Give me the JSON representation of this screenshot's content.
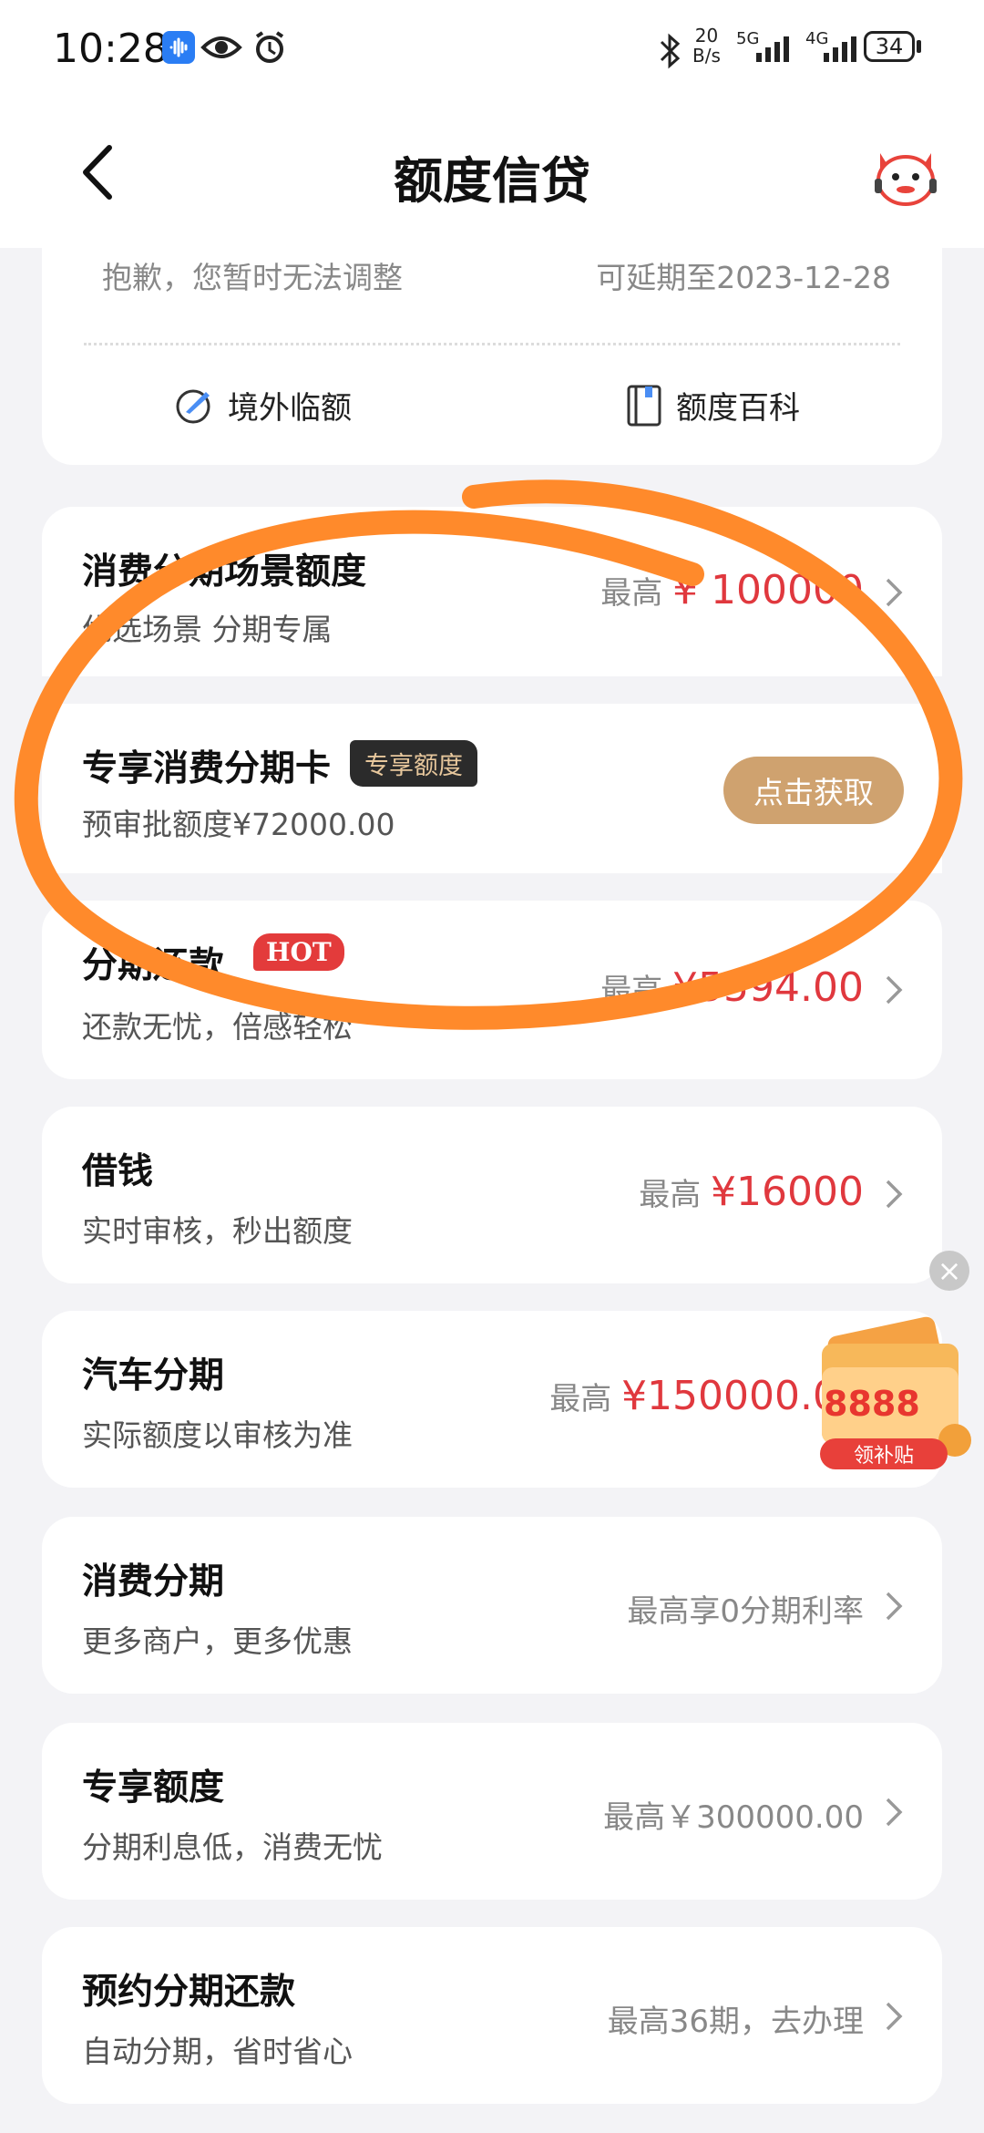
{
  "status": {
    "time": "10:28",
    "speed": "20",
    "speed_unit": "B/s",
    "net1": "5G",
    "net2": "4G",
    "battery": "34"
  },
  "header": {
    "title": "额度信贷"
  },
  "top_card": {
    "notice": "抱歉，您暂时无法调整",
    "extend": "可延期至2023-12-28",
    "links": [
      {
        "label": "境外临额"
      },
      {
        "label": "额度百科"
      }
    ]
  },
  "rows": [
    {
      "title": "消费分期场景额度",
      "subtitle": "优选场景 分期专属",
      "prefix": "最高",
      "amount": "¥ 100000"
    },
    {
      "title": "专享消费分期卡",
      "badge": "专享额度",
      "subtitle": "预审批额度¥72000.00",
      "button": "点击获取"
    },
    {
      "title": "分期还款",
      "badge": "HOT",
      "subtitle": "还款无忧，倍感轻松",
      "prefix": "最高",
      "amount": "¥5594.00"
    },
    {
      "title": "借钱",
      "subtitle": "实时审核，秒出额度",
      "prefix": "最高",
      "amount": "¥16000"
    },
    {
      "title": "汽车分期",
      "subtitle": "实际额度以审核为准",
      "prefix": "最高",
      "amount": "¥150000.00"
    },
    {
      "title": "消费分期",
      "subtitle": "更多商户，更多优惠",
      "right": "最高享0分期利率"
    },
    {
      "title": "专享额度",
      "subtitle": "分期利息低，消费无忧",
      "right": "最高￥300000.00"
    },
    {
      "title": "预约分期还款",
      "subtitle": "自动分期，省时省心",
      "right": "最高36期，去办理"
    }
  ],
  "promo": {
    "amount": "8888",
    "button": "领补贴"
  },
  "colors": {
    "accent_red": "#e0383e",
    "gold": "#cfa26f",
    "annotation_orange": "#ff8a2b"
  }
}
